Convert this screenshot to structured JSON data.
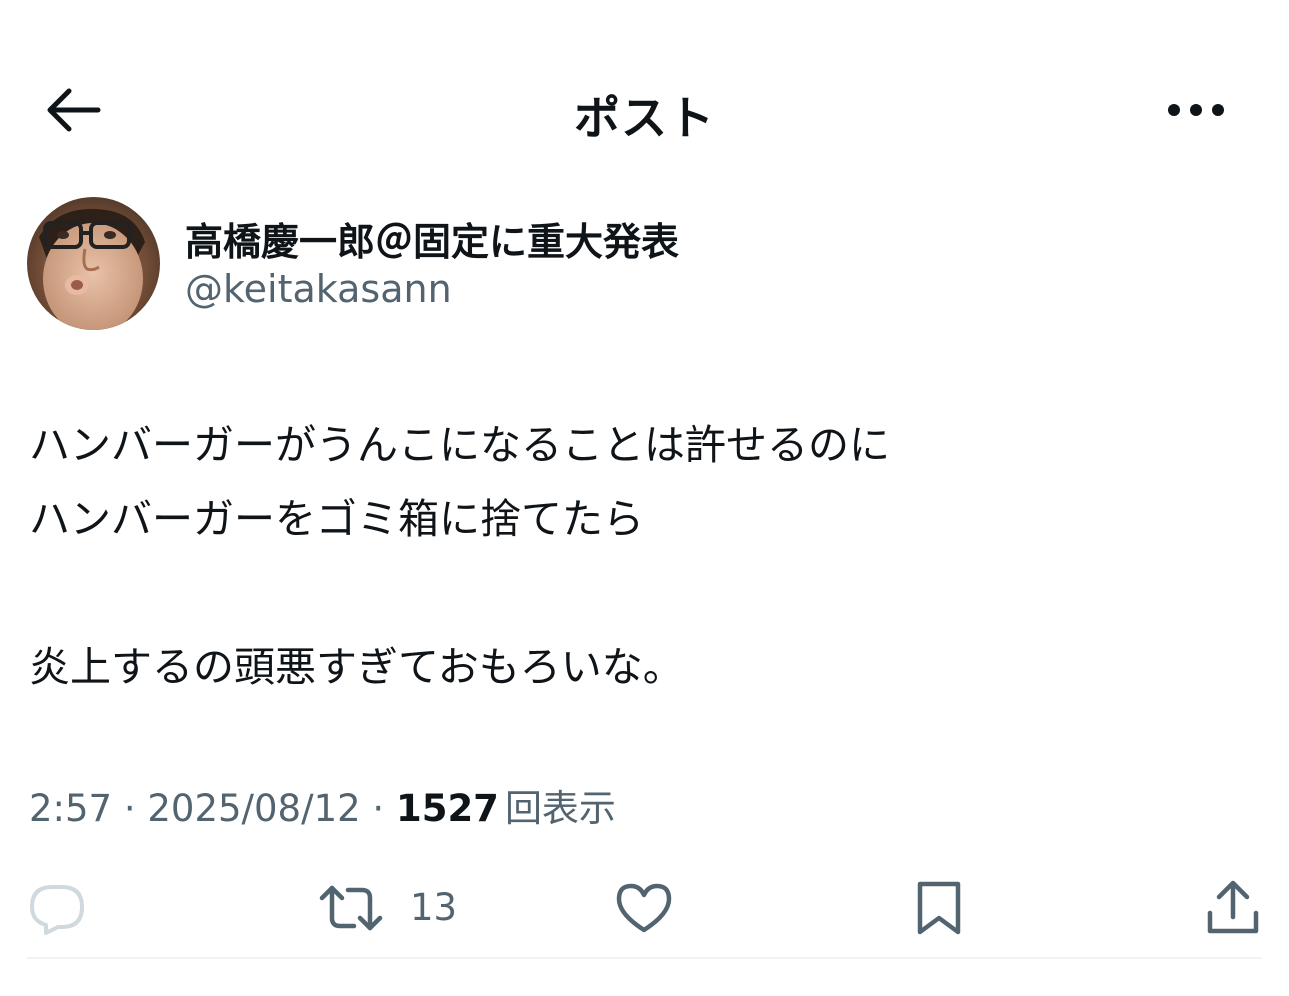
{
  "header": {
    "title": "ポスト",
    "back_icon": "arrow-left-icon",
    "more_icon": "more-horizontal-icon"
  },
  "author": {
    "name": "高橋慶一郎＠固定に重大発表",
    "handle": "@keitakasann"
  },
  "post": {
    "lines": [
      "ハンバーガーがうんこになることは許せるのに",
      "ハンバーガーをゴミ箱に捨てたら",
      "",
      "炎上するの頭悪すぎておもろいな。"
    ]
  },
  "meta": {
    "time": "2:57",
    "separator": "·",
    "date": "2025/08/12",
    "views_count": "1527",
    "views_label": "回表示"
  },
  "actions": {
    "reply_icon": "reply-icon",
    "repost_icon": "repost-icon",
    "repost_count": "13",
    "like_icon": "heart-icon",
    "bookmark_icon": "bookmark-icon",
    "share_icon": "share-icon"
  },
  "colors": {
    "text_primary": "#0f1419",
    "text_secondary": "#536471",
    "icon": "#536471",
    "divider": "#eff3f4"
  }
}
